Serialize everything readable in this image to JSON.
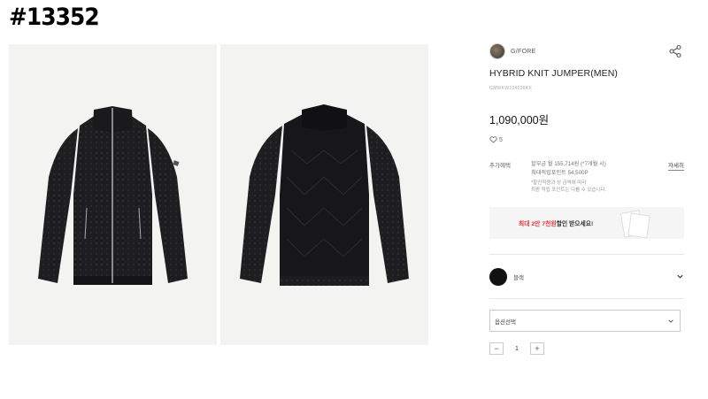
{
  "post_number": "#13352",
  "product": {
    "brand": "G/FORE",
    "name": "HYBRID KNIT JUMPER(MEN)",
    "code": "GMWKW234028KX",
    "price": "1,090,000원",
    "likes": "5",
    "color_label": "블랙",
    "option_placeholder": "옵션선택",
    "quantity": "1"
  },
  "benefit": {
    "label": "추가혜택",
    "line1": "할부금 월 155,714원 (*7개월 시)",
    "line2": "최대적립포인트 54,500P",
    "note1": "*할인적용과 상 금액에 따라",
    "note2": "최종 적립 포인트는 다를 수 있습니다.",
    "more": "자세히"
  },
  "coupon": {
    "highlight": "최대 2만 7천원",
    "rest": " 할인 받으세요!"
  },
  "icons": {
    "share": "share-icon",
    "heart": "heart-icon",
    "chevron": "chevron-down-icon",
    "minus": "minus-icon",
    "plus": "plus-icon"
  },
  "colors": {
    "coupon_highlight": "#e03b3b",
    "jacket": "#1c1c1e"
  }
}
